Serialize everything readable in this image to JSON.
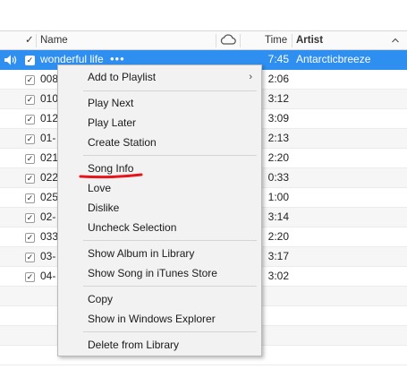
{
  "header": {
    "check_label": "✓",
    "name_label": "Name",
    "cloud_icon": "cloud-icon",
    "time_label": "Time",
    "artist_label": "Artist",
    "sort_icon": "chevron-up-icon"
  },
  "rows": [
    {
      "name": "wonderful life",
      "more": "•••",
      "time": "7:45",
      "artist": "Antarcticbreeze",
      "selected": true,
      "playing": true
    },
    {
      "name": "008",
      "time": "2:06"
    },
    {
      "name": "010",
      "time": "3:12"
    },
    {
      "name": "012",
      "time": "3:09"
    },
    {
      "name": "01-",
      "time": "2:13"
    },
    {
      "name": "021",
      "time": "2:20"
    },
    {
      "name": "022",
      "time": "0:33"
    },
    {
      "name": "025",
      "time": "1:00"
    },
    {
      "name": "02-",
      "time": "3:14"
    },
    {
      "name": "033",
      "time": "2:20"
    },
    {
      "name": "03-",
      "time": "3:17"
    },
    {
      "name": "04-",
      "time": "3:02"
    }
  ],
  "context_menu": {
    "add_to_playlist": "Add to Playlist",
    "submenu_arrow": "›",
    "play_next": "Play Next",
    "play_later": "Play Later",
    "create_station": "Create Station",
    "song_info": "Song Info",
    "love": "Love",
    "dislike": "Dislike",
    "uncheck_selection": "Uncheck Selection",
    "show_album": "Show Album in Library",
    "show_song_store": "Show Song in iTunes Store",
    "copy": "Copy",
    "show_explorer": "Show in Windows Explorer",
    "delete": "Delete from Library"
  },
  "colors": {
    "selection": "#2e8ff0",
    "annotation": "#e8141c"
  }
}
